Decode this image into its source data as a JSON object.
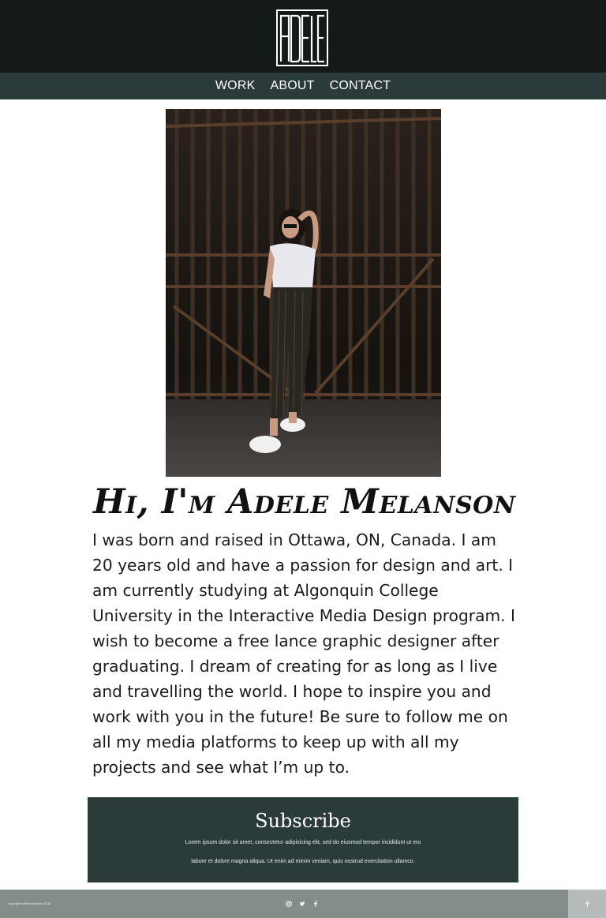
{
  "brand": {
    "logo_text": "ADELE"
  },
  "nav": {
    "items": [
      {
        "label": "WORK"
      },
      {
        "label": "ABOUT"
      },
      {
        "label": "CONTACT"
      }
    ]
  },
  "about": {
    "heading": "Hi, I'm Adele Melanson",
    "bio": "I was born and raised in Ottawa, ON, Canada. I am 20 years old and have a passion for design and art. I am currently studying at Algonquin College University in the Interactive Media Design program. I wish to become a free lance graphic designer after graduating. I dream of creating for as long as I live and travelling the world. I hope to inspire you and work with you in the future! Be sure to follow me on all my media platforms to keep up with all my projects and see what I’m up to."
  },
  "subscribe": {
    "title": "Subscribe",
    "line1": "Lorem ipsum dolor sit amet, consectetur adipisicing elit, sed do eiusmod tempor incididunt ut ero",
    "line2": "labore et dolore magna aliqua. Ut enim ad minim veniam, quis nostrud exercitation ullamco."
  },
  "footer": {
    "copyright": "copyright adelemelanson 2018",
    "social_icons": [
      "instagram-icon",
      "twitter-icon",
      "facebook-icon"
    ],
    "back_to_top_icon": "arrow-up-icon"
  },
  "colors": {
    "header_bg": "#131a19",
    "nav_bg": "#2b3b39",
    "subscribe_bg": "#2b3b39",
    "footer_bg": "#858d8b",
    "back_to_top_bg": "#b6bcbb"
  }
}
